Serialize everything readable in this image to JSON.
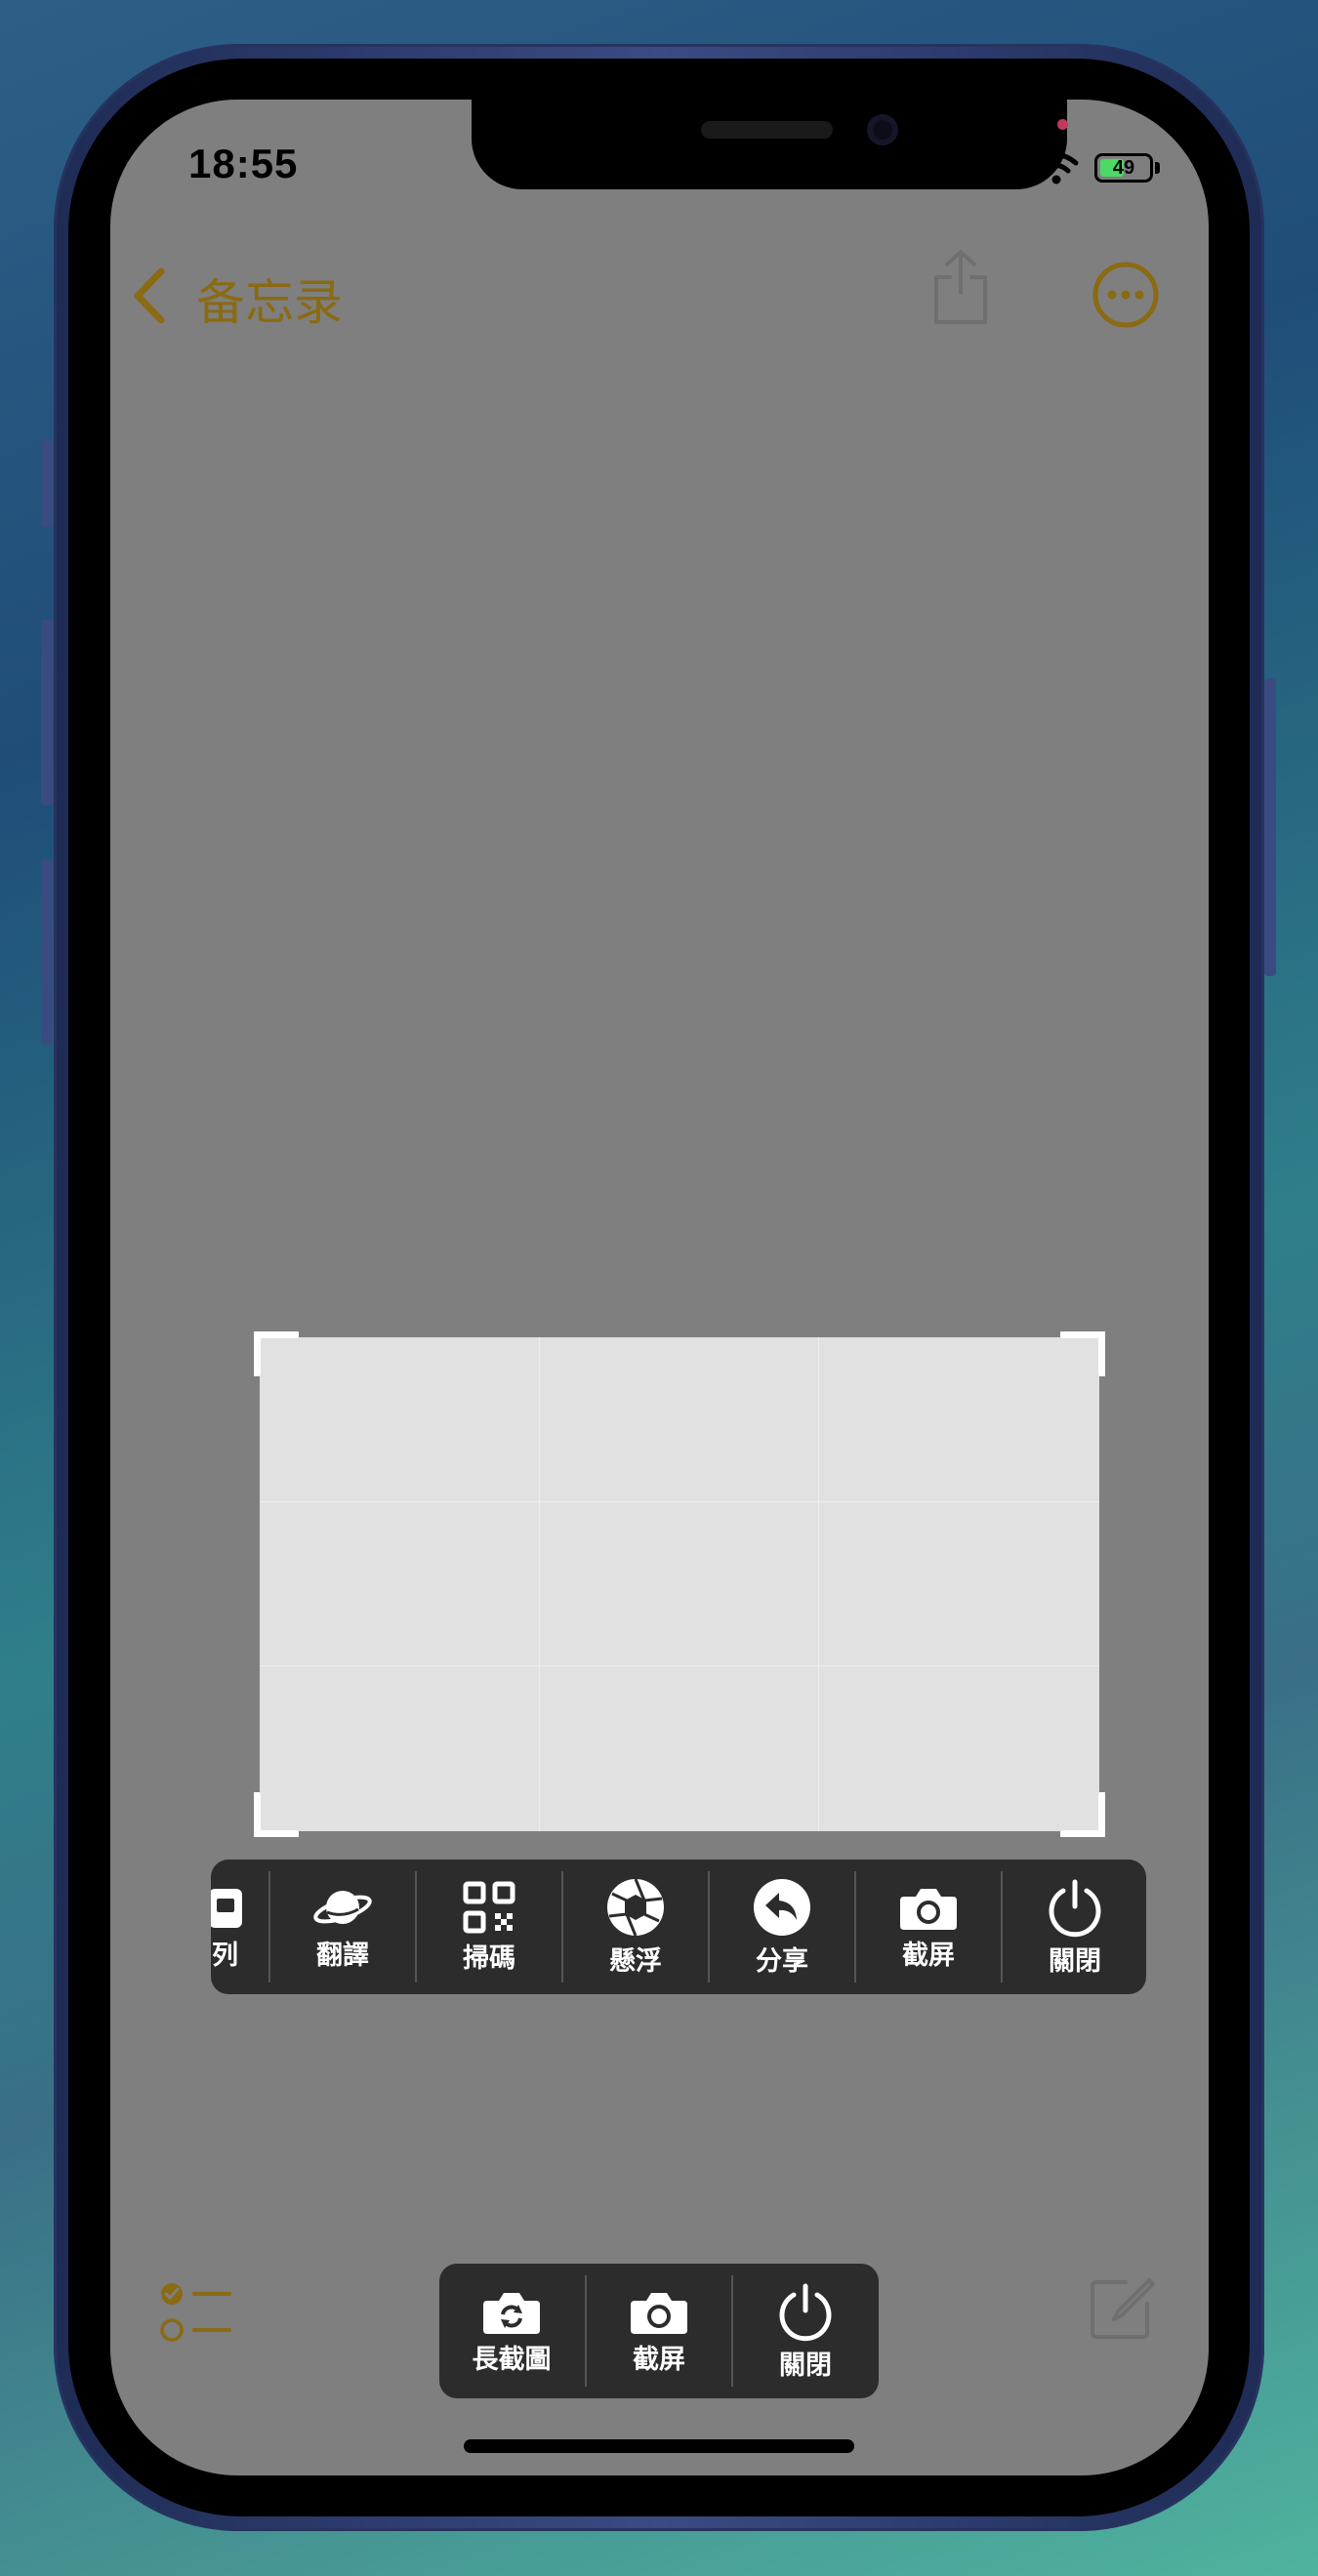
{
  "status_bar": {
    "time": "18:55",
    "battery_level": "49",
    "battery_percent": 49
  },
  "nav": {
    "back_label": "备忘录",
    "share_icon": "share-icon",
    "more_icon": "ellipsis-circle-icon"
  },
  "colors": {
    "accent": "#8a6a12",
    "screen_bg": "#7f7f7f",
    "toolbar_bg": "#2c2c2c",
    "crop_fill": "#e1e1e1"
  },
  "screenshot_toolbar": {
    "items": [
      {
        "label": "列",
        "icon": "document-icon"
      },
      {
        "label": "翻譯",
        "icon": "planet-icon"
      },
      {
        "label": "掃碼",
        "icon": "qr-code-icon"
      },
      {
        "label": "懸浮",
        "icon": "aperture-icon"
      },
      {
        "label": "分享",
        "icon": "reply-arrow-icon"
      },
      {
        "label": "截屏",
        "icon": "camera-icon"
      },
      {
        "label": "關閉",
        "icon": "power-icon"
      }
    ]
  },
  "bottom_toolbar": {
    "items": [
      {
        "label": "長截圖",
        "icon": "camera-rotate-icon"
      },
      {
        "label": "截屏",
        "icon": "camera-icon"
      },
      {
        "label": "關閉",
        "icon": "power-icon"
      }
    ]
  },
  "bottom_bar": {
    "checklist_icon": "checklist-icon",
    "compose_icon": "compose-icon"
  }
}
